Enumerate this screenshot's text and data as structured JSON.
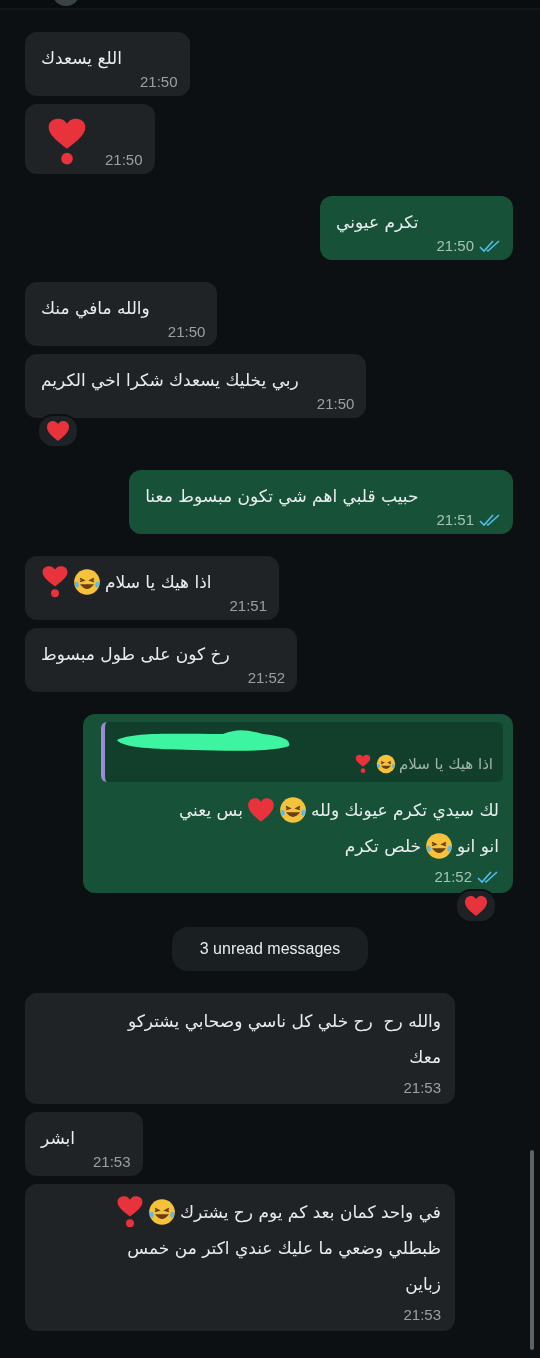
{
  "messages": [
    {
      "kind": "incoming",
      "lines": [
        [
          {
            "kind": "text",
            "text": "اللع يسعدك"
          }
        ]
      ],
      "time": "21:50"
    },
    {
      "kind": "incoming",
      "lines": [
        [
          {
            "kind": "heart_exclaim"
          }
        ]
      ],
      "time": "21:50"
    },
    {
      "kind": "outgoing",
      "lines": [
        [
          {
            "kind": "text",
            "text": "تكرم عيوني"
          }
        ]
      ],
      "time": "21:50",
      "read": true
    },
    {
      "kind": "incoming",
      "lines": [
        [
          {
            "kind": "text",
            "text": "والله مافي منك"
          }
        ]
      ],
      "time": "21:50"
    },
    {
      "kind": "incoming",
      "lines": [
        [
          {
            "kind": "text",
            "text": "ربي يخليك يسعدك شكرا اخي الكريم"
          }
        ]
      ],
      "time": "21:50",
      "reaction": {
        "kind": "heart"
      }
    },
    {
      "kind": "outgoing",
      "lines": [
        [
          {
            "kind": "text",
            "text": "حبيب قلبي اهم شي تكون مبسوط معنا"
          }
        ]
      ],
      "time": "21:51",
      "read": true
    },
    {
      "kind": "incoming",
      "lines": [
        [
          {
            "kind": "text",
            "text": "اذا هيك يا سلام"
          },
          {
            "kind": "laugh"
          },
          {
            "kind": "heart_exclaim"
          }
        ]
      ],
      "time": "21:51"
    },
    {
      "kind": "incoming",
      "lines": [
        [
          {
            "kind": "text",
            "text": "رخ كون على طول مبسوط"
          }
        ]
      ],
      "time": "21:52"
    },
    {
      "kind": "outgoing",
      "quote": {
        "parts": [
          {
            "kind": "text",
            "text": "اذا هيك يا سلام"
          },
          {
            "kind": "laugh"
          },
          {
            "kind": "heart_exclaim"
          }
        ]
      },
      "lines": [
        [
          {
            "kind": "text",
            "text": "لك سيدي تكرم عيونك ولله"
          },
          {
            "kind": "laugh"
          },
          {
            "kind": "heart"
          },
          {
            "kind": "text",
            "text": "بس يعني"
          }
        ],
        [
          {
            "kind": "text",
            "text": "انو انو"
          },
          {
            "kind": "laugh"
          },
          {
            "kind": "text",
            "text": "خلص تكرم"
          }
        ]
      ],
      "time": "21:52",
      "read": true,
      "reaction": {
        "kind": "heart"
      }
    },
    {
      "kind": "system",
      "label": "3 unread messages"
    },
    {
      "kind": "incoming",
      "lines": [
        [
          {
            "kind": "text",
            "text": "والله رح  رح خلي كل ناسي وصحابي يشتركو"
          }
        ],
        [
          {
            "kind": "text",
            "text": "معك"
          }
        ]
      ],
      "time": "21:53"
    },
    {
      "kind": "incoming",
      "lines": [
        [
          {
            "kind": "text",
            "text": "ابشر"
          }
        ]
      ],
      "time": "21:53"
    },
    {
      "kind": "incoming",
      "lines": [
        [
          {
            "kind": "text",
            "text": "في واحد كمان بعد كم يوم رح يشترك"
          },
          {
            "kind": "laugh"
          },
          {
            "kind": "heart_exclaim"
          }
        ],
        [
          {
            "kind": "text",
            "text": "ظبطلي وضعي ما عليك عندي اكتر من خمس"
          }
        ],
        [
          {
            "kind": "text",
            "text": "زباين"
          }
        ]
      ],
      "time": "21:53"
    }
  ]
}
